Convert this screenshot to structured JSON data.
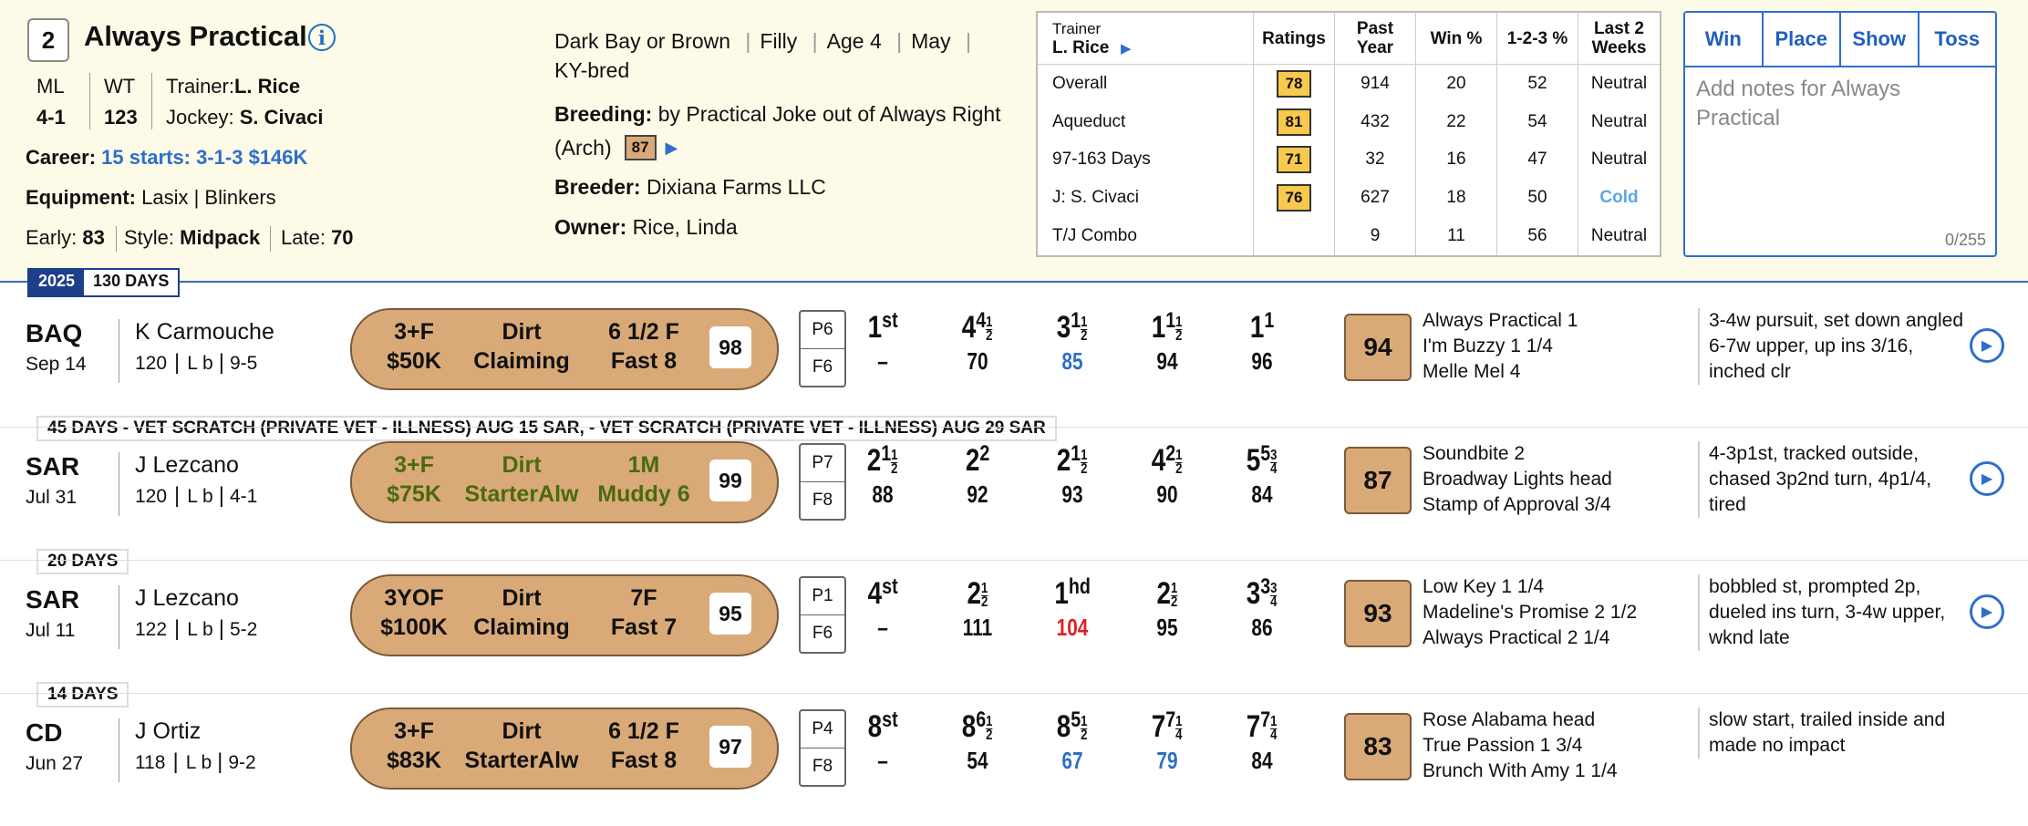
{
  "horse": {
    "program_number": "2",
    "name": "Always Practical",
    "ml_label": "ML",
    "ml": "4-1",
    "wt_label": "WT",
    "wt": "123",
    "trainer_label": "Trainer:",
    "trainer": "L. Rice",
    "jockey_label": "Jockey:",
    "jockey": "S. Civaci",
    "career_label": "Career:",
    "career": "15 starts: 3-1-3 $146K",
    "equipment_label": "Equipment:",
    "equipment": "Lasix | Blinkers",
    "early_label": "Early:",
    "early": "83",
    "style_label": "Style:",
    "style": "Midpack",
    "late_label": "Late:",
    "late": "70",
    "color": "Dark Bay or Brown",
    "sex": "Filly",
    "age": "Age 4",
    "foal_month": "May",
    "bred": "KY-bred",
    "breeding_label": "Breeding:",
    "breeding_line1": "by Practical Joke out of Always Right",
    "breeding_line2": "(Arch)",
    "breeding_rating": "87",
    "breeder_label": "Breeder:",
    "breeder": "Dixiana Farms LLC",
    "owner_label": "Owner:",
    "owner": "Rice, Linda"
  },
  "stats_table": {
    "trainer_label": "Trainer",
    "trainer_name": "L. Rice",
    "headers": [
      "Ratings",
      "Past Year",
      "Win %",
      "1-2-3 %",
      "Last 2 Weeks"
    ],
    "rows": [
      {
        "label": "Overall",
        "rating": "78",
        "past_year": "914",
        "win": "20",
        "itm": "52",
        "trend": "Neutral"
      },
      {
        "label": "Aqueduct",
        "rating": "81",
        "past_year": "432",
        "win": "22",
        "itm": "54",
        "trend": "Neutral"
      },
      {
        "label": "97-163 Days",
        "rating": "71",
        "past_year": "32",
        "win": "16",
        "itm": "47",
        "trend": "Neutral"
      },
      {
        "label": "J: S. Civaci",
        "rating": "76",
        "past_year": "627",
        "win": "18",
        "itm": "50",
        "trend": "Cold"
      },
      {
        "label": "T/J Combo",
        "rating": "",
        "past_year": "9",
        "win": "11",
        "itm": "56",
        "trend": "Neutral"
      }
    ],
    "cold_color": "#5aa8e8"
  },
  "wager": {
    "buttons": [
      "Win",
      "Place",
      "Show",
      "Toss"
    ],
    "notes_placeholder": "Add notes for Always Practical",
    "counter": "0/255"
  },
  "year_bar": {
    "year": "2025",
    "days": "130 DAYS"
  },
  "races": [
    {
      "track": "BAQ",
      "date": "Sep 14",
      "jockey": "K Carmouche",
      "weight": "120",
      "meds": "L b",
      "odds": "9-5",
      "cond1": "3+F",
      "purse": "$50K",
      "surface": "Dirt",
      "race_type": "Claiming",
      "distance": "6 1/2 F",
      "track_cond": "Fast 8",
      "speed_fig": "98",
      "post": "P6",
      "field": "F6",
      "calls": [
        {
          "pos": "1",
          "sup": "st",
          "frac": "",
          "sub": "–"
        },
        {
          "pos": "4",
          "sup": "4",
          "frac": "1/2",
          "sub": "70"
        },
        {
          "pos": "3",
          "sup": "1",
          "frac": "1/2",
          "sub": "85"
        },
        {
          "pos": "1",
          "sup": "1",
          "frac": "1/2",
          "sub": "94"
        },
        {
          "pos": "1",
          "sup": "1",
          "frac": "",
          "sub": "96"
        }
      ],
      "beyer": "94",
      "finishers": [
        "Always Practical  1",
        "I'm Buzzy  1 1/4",
        "Melle Mel  4"
      ],
      "comment": "3-4w pursuit, set down angled 6-7w upper, up ins 3/16, inched clr",
      "gap_note": "45 DAYS - VET SCRATCH (PRIVATE VET - ILLNESS) AUG 15 SAR, - VET SCRATCH (PRIVATE VET - ILLNESS) AUG 29 SAR"
    },
    {
      "track": "SAR",
      "date": "Jul 31",
      "jockey": "J Lezcano",
      "weight": "120",
      "meds": "L b",
      "odds": "4-1",
      "cond1": "3+F",
      "purse": "$75K",
      "surface": "Dirt",
      "race_type": "StarterAlw",
      "distance": "1M",
      "track_cond": "Muddy 6",
      "speed_fig": "99",
      "post": "P7",
      "field": "F8",
      "calls": [
        {
          "pos": "2",
          "sup": "1",
          "frac": "1/2",
          "sub": "88"
        },
        {
          "pos": "2",
          "sup": "2",
          "frac": "",
          "sub": "92"
        },
        {
          "pos": "2",
          "sup": "1",
          "frac": "1/2",
          "sub": "93"
        },
        {
          "pos": "4",
          "sup": "2",
          "frac": "1/2",
          "sub": "90"
        },
        {
          "pos": "5",
          "sup": "5",
          "frac": "3/4",
          "sub": "84"
        }
      ],
      "beyer": "87",
      "finishers": [
        "Soundbite  2",
        "Broadway Lights  head",
        "Stamp of Approval  3/4"
      ],
      "comment": "4-3p1st, tracked outside, chased 3p2nd turn, 4p1/4, tired",
      "gap_note": "20 DAYS"
    },
    {
      "track": "SAR",
      "date": "Jul 11",
      "jockey": "J Lezcano",
      "weight": "122",
      "meds": "L b",
      "odds": "5-2",
      "cond1": "3YOF",
      "purse": "$100K",
      "surface": "Dirt",
      "race_type": "Claiming",
      "distance": "7F",
      "track_cond": "Fast 7",
      "speed_fig": "95",
      "post": "P1",
      "field": "F6",
      "calls": [
        {
          "pos": "4",
          "sup": "st",
          "frac": "",
          "sub": "–"
        },
        {
          "pos": "2",
          "sup": "",
          "frac": "1/2",
          "sub": "111"
        },
        {
          "pos": "1",
          "sup": "hd",
          "frac": "",
          "sub": "104"
        },
        {
          "pos": "2",
          "sup": "",
          "frac": "1/2",
          "sub": "95"
        },
        {
          "pos": "3",
          "sup": "3",
          "frac": "3/4",
          "sub": "86"
        }
      ],
      "beyer": "93",
      "finishers": [
        "Low Key  1 1/4",
        "Madeline's Promise  2 1/2",
        "Always Practical  2 1/4"
      ],
      "comment": "bobbled st, prompted 2p, dueled ins turn, 3-4w upper, wknd late",
      "gap_note": "14 DAYS"
    },
    {
      "track": "CD",
      "date": "Jun 27",
      "jockey": "J Ortiz",
      "weight": "118",
      "meds": "L b",
      "odds": "9-2",
      "cond1": "3+F",
      "purse": "$83K",
      "surface": "Dirt",
      "race_type": "StarterAlw",
      "distance": "6 1/2 F",
      "track_cond": "Fast 8",
      "speed_fig": "97",
      "post": "P4",
      "field": "F8",
      "calls": [
        {
          "pos": "8",
          "sup": "st",
          "frac": "",
          "sub": "–"
        },
        {
          "pos": "8",
          "sup": "6",
          "frac": "1/2",
          "sub": "54"
        },
        {
          "pos": "8",
          "sup": "5",
          "frac": "1/2",
          "sub": "67"
        },
        {
          "pos": "7",
          "sup": "7",
          "frac": "1/4",
          "sub": "79"
        },
        {
          "pos": "7",
          "sup": "7",
          "frac": "1/4",
          "sub": "84"
        }
      ],
      "beyer": "83",
      "finishers": [
        "Rose Alabama  head",
        "True Passion  1 3/4",
        "Brunch With Amy  1 1/4"
      ],
      "comment": "slow start, trailed inside and made no impact",
      "gap_note": ""
    }
  ],
  "colors": {
    "accent": "#2e6fcb",
    "pill": "#d9aa78",
    "muddy_text": "#4a6a10",
    "red_fig": "#e02020",
    "blue_fig": "#2e6fcb"
  }
}
